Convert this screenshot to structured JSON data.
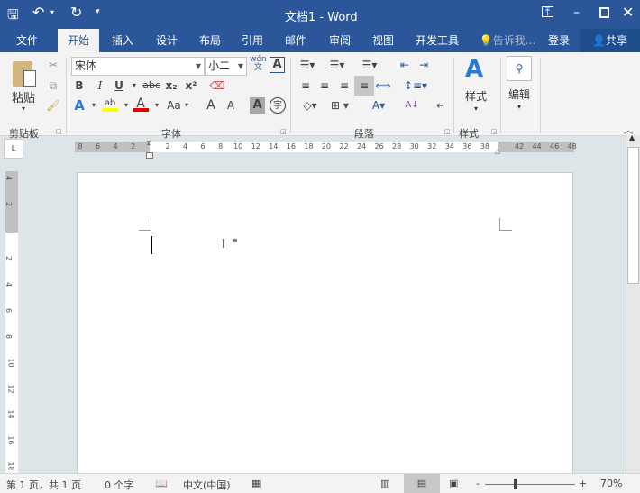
{
  "title": "文档1 - Word",
  "qat": {
    "save": "save-icon",
    "undo": "↶",
    "redo": "↻"
  },
  "tabs": [
    "文件",
    "开始",
    "插入",
    "设计",
    "布局",
    "引用",
    "邮件",
    "审阅",
    "视图",
    "开发工具"
  ],
  "tell_me": "告诉我...",
  "login": "登录",
  "share": "共享",
  "clipboard": {
    "paste": "粘贴",
    "group": "剪贴板"
  },
  "font": {
    "name": "宋体",
    "size": "小二",
    "group": "字体",
    "phonetic": "wén",
    "phonetic_char": "文",
    "bold": "B",
    "italic": "I",
    "underline": "U",
    "strike": "abc",
    "sub": "x₂",
    "sup": "x²",
    "case": "Aa",
    "grow": "A",
    "shrink": "A",
    "shade": "A",
    "enclose": "字",
    "highlight_color": "#ffff00",
    "font_color": "#e00000"
  },
  "paragraph": {
    "group": "段落",
    "sort": "A↓"
  },
  "styles": {
    "label": "样式",
    "group": "样式"
  },
  "editing": {
    "label": "编辑"
  },
  "ruler": {
    "corner": "L",
    "left": [
      "8",
      "6",
      "4",
      "2"
    ],
    "main": [
      "2",
      "4",
      "6",
      "8",
      "10",
      "12",
      "14",
      "16",
      "18",
      "20",
      "22",
      "24",
      "26",
      "28",
      "30",
      "32",
      "34",
      "36",
      "38"
    ],
    "right": [
      "42",
      "44",
      "46",
      "48"
    ],
    "vtop": [
      "4",
      "2"
    ],
    "vmain": [
      "2",
      "4",
      "6",
      "8",
      "10",
      "12",
      "14",
      "16",
      "18"
    ]
  },
  "status": {
    "page": "第 1 页，共 1 页",
    "words": "0 个字",
    "lang": "中文(中国)",
    "zoom": "70%",
    "zoom_level_percent": 70
  },
  "accent": "#2b579a"
}
